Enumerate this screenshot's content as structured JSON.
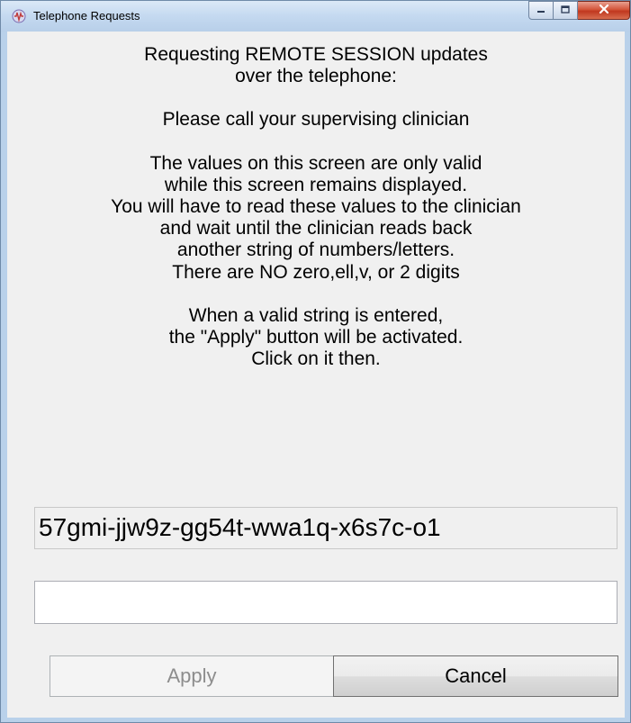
{
  "window": {
    "title": "Telephone Requests",
    "controls": {
      "minimize_icon": "minimize-icon",
      "maximize_icon": "maximize-icon",
      "close_icon": "close-icon"
    }
  },
  "message": {
    "heading_line1": "Requesting REMOTE SESSION updates",
    "heading_line2": "over the telephone:",
    "call_line": "Please call your supervising clinician",
    "info_line1": "The values on this screen are only valid",
    "info_line2": "while this screen remains displayed.",
    "info_line3": "You will have to read these values to the clinician",
    "info_line4": "and wait until the clinician reads back",
    "info_line5": "another string of numbers/letters.",
    "info_line6": "There are NO zero,ell,v, or 2 digits",
    "apply_line1": "When a valid string is entered,",
    "apply_line2": "the \"Apply\" button will be activated.",
    "apply_line3": "Click on it then."
  },
  "code": {
    "value": "57gmi-jjw9z-gg54t-wwa1q-x6s7c-o1"
  },
  "entry": {
    "value": "",
    "placeholder": ""
  },
  "buttons": {
    "apply_label": "Apply",
    "cancel_label": "Cancel"
  },
  "colors": {
    "title_bar": "#c4d9f0",
    "client_bg": "#f0f0f0",
    "close_button": "#c0381f",
    "disabled_text": "#8d8d8d"
  }
}
